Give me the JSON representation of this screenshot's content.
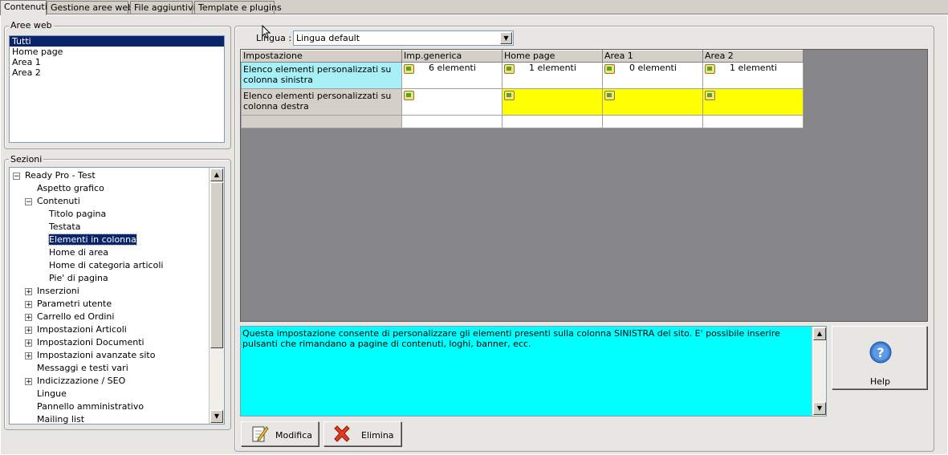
{
  "tabs": [
    "Contenuti",
    "Gestione aree web",
    "File aggiuntivi",
    "Template e plugins"
  ],
  "aree_web": {
    "title": "Aree web",
    "items": [
      "Tutti",
      "Home page",
      "Area 1",
      "Area 2"
    ],
    "selected": "Tutti"
  },
  "sezioni": {
    "title": "Sezioni",
    "tree": [
      {
        "label": "Ready Pro - Test",
        "level": 0,
        "expander": "−"
      },
      {
        "label": "Aspetto grafico",
        "level": 1,
        "expander": ""
      },
      {
        "label": "Contenuti",
        "level": 1,
        "expander": "−"
      },
      {
        "label": "Titolo pagina",
        "level": 2,
        "expander": ""
      },
      {
        "label": "Testata",
        "level": 2,
        "expander": ""
      },
      {
        "label": "Elementi in colonna",
        "level": 2,
        "expander": "",
        "selected": true
      },
      {
        "label": "Home di area",
        "level": 2,
        "expander": ""
      },
      {
        "label": "Home di categoria articoli",
        "level": 2,
        "expander": ""
      },
      {
        "label": "Pie' di pagina",
        "level": 2,
        "expander": ""
      },
      {
        "label": "Inserzioni",
        "level": 1,
        "expander": "+"
      },
      {
        "label": "Parametri utente",
        "level": 1,
        "expander": "+"
      },
      {
        "label": "Carrello ed Ordini",
        "level": 1,
        "expander": "+"
      },
      {
        "label": "Impostazioni Articoli",
        "level": 1,
        "expander": "+"
      },
      {
        "label": "Impostazioni Documenti",
        "level": 1,
        "expander": "+"
      },
      {
        "label": "Impostazioni avanzate sito",
        "level": 1,
        "expander": "+"
      },
      {
        "label": "Messaggi e testi vari",
        "level": 1,
        "expander": ""
      },
      {
        "label": "Indicizzazione / SEO",
        "level": 1,
        "expander": "+"
      },
      {
        "label": "Lingue",
        "level": 1,
        "expander": ""
      },
      {
        "label": "Pannello amministrativo",
        "level": 1,
        "expander": ""
      },
      {
        "label": "Mailing list",
        "level": 1,
        "expander": ""
      }
    ]
  },
  "lingua": {
    "label": "Lingua :",
    "value": "Lingua default"
  },
  "grid": {
    "headers": [
      "Impostazione",
      "Imp.generica",
      "Home page",
      "Area 1",
      "Area 2"
    ],
    "rows": [
      {
        "label": "Elenco elementi personalizzati su colonna sinistra",
        "cells": [
          "6 elementi",
          "1 elementi",
          "0 elementi",
          "1 elementi"
        ]
      },
      {
        "label": "Elenco elementi personalizzati su colonna destra",
        "cells": [
          "",
          "",
          "",
          ""
        ]
      }
    ]
  },
  "description": "Questa impostazione consente di personalizzare gli elementi presenti sulla colonna SINISTRA del sito. E' possibile inserire pulsanti che rimandano a pagine di contenuti, loghi, banner, ecc.",
  "buttons": {
    "help": "Help",
    "modifica": "Modifica",
    "elimina": "Elimina"
  },
  "colors": {
    "row1_label_bg": "#a8f0f8",
    "row2_highlight": "#ffff00",
    "description_bg": "#00ffff",
    "selection": "#0a246a"
  }
}
